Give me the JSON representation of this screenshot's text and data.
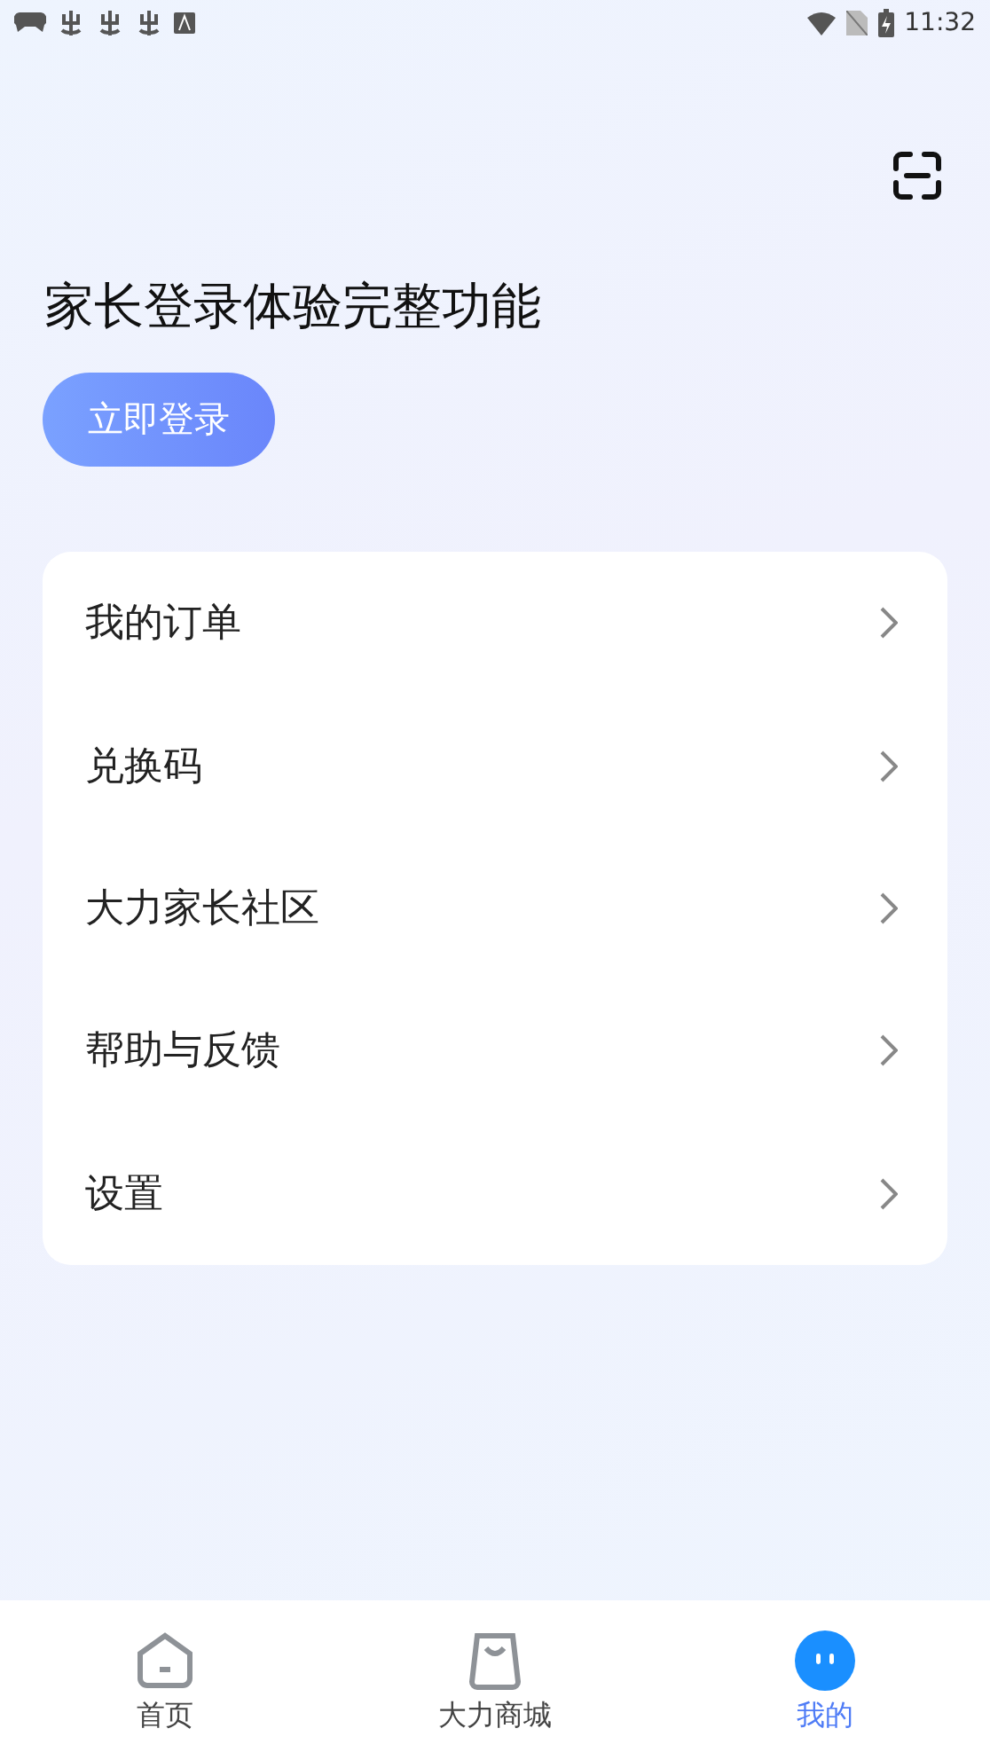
{
  "status_bar": {
    "time": "11:32"
  },
  "header": {
    "title": "家长登录体验完整功能",
    "login_button": "立即登录"
  },
  "menu": [
    {
      "label": "我的订单"
    },
    {
      "label": "兑换码"
    },
    {
      "label": "大力家长社区"
    },
    {
      "label": "帮助与反馈"
    },
    {
      "label": "设置"
    }
  ],
  "tabs": [
    {
      "kind": "home",
      "label": "首页",
      "selected": false
    },
    {
      "kind": "shop",
      "label": "大力商城",
      "selected": false
    },
    {
      "kind": "me",
      "label": "我的",
      "selected": true
    }
  ]
}
